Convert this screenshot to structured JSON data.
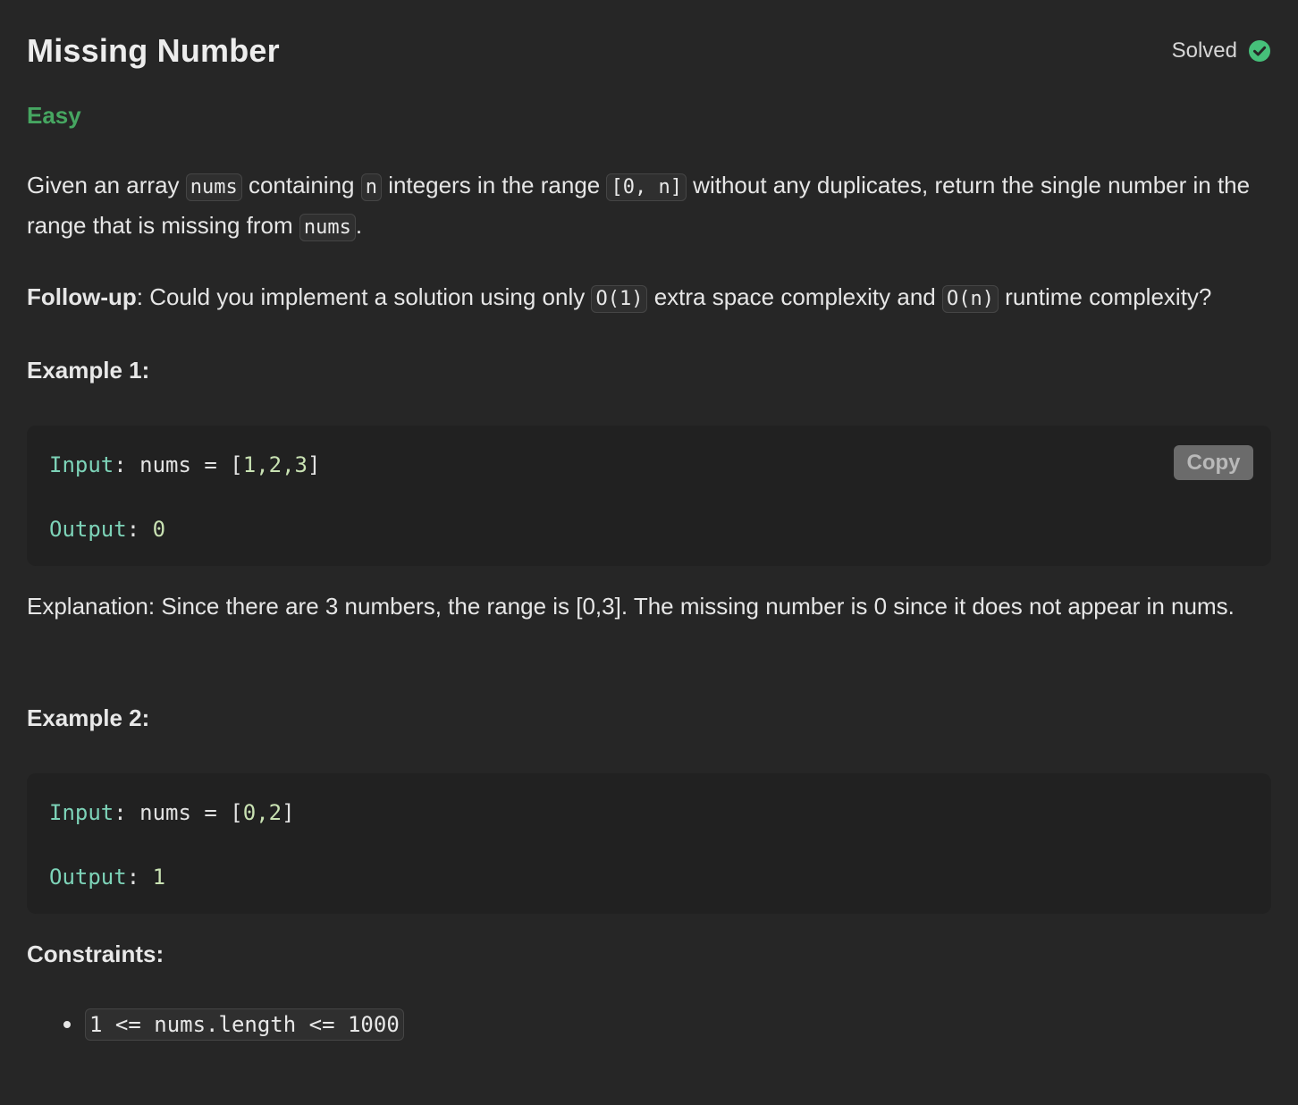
{
  "problem": {
    "title": "Missing Number",
    "status": "Solved",
    "status_icon": "check-circle-icon",
    "status_color": "#46c07a",
    "difficulty": "Easy",
    "difficulty_color": "#46a661"
  },
  "description": {
    "p1_t1": "Given an array ",
    "p1_c1": "nums",
    "p1_t2": " containing ",
    "p1_c2": "n",
    "p1_t3": " integers in the range ",
    "p1_c3": "[0, n]",
    "p1_t4": " without any duplicates, return the single number in the range that is missing from ",
    "p1_c4": "nums",
    "p1_t5": ".",
    "followup_label": "Follow-up",
    "followup_t1": ": Could you implement a solution using only ",
    "followup_c1": "O(1)",
    "followup_t2": " extra space complexity and ",
    "followup_c2": "O(n)",
    "followup_t3": " runtime complexity?"
  },
  "examples": [
    {
      "heading": "Example 1:",
      "input_label": "Input",
      "input_prefix": ": nums = [",
      "input_values": "1,2,3",
      "input_suffix": "]",
      "output_label": "Output",
      "output_sep": ": ",
      "output_value": "0",
      "copy_label": "Copy",
      "explanation": "Explanation: Since there are 3 numbers, the range is [0,3]. The missing number is 0 since it does not appear in nums."
    },
    {
      "heading": "Example 2:",
      "input_label": "Input",
      "input_prefix": ": nums = [",
      "input_values": "0,2",
      "input_suffix": "]",
      "output_label": "Output",
      "output_sep": ": ",
      "output_value": "1"
    }
  ],
  "constraints": {
    "heading": "Constraints:",
    "items": [
      "1 <= nums.length <= 1000"
    ]
  }
}
